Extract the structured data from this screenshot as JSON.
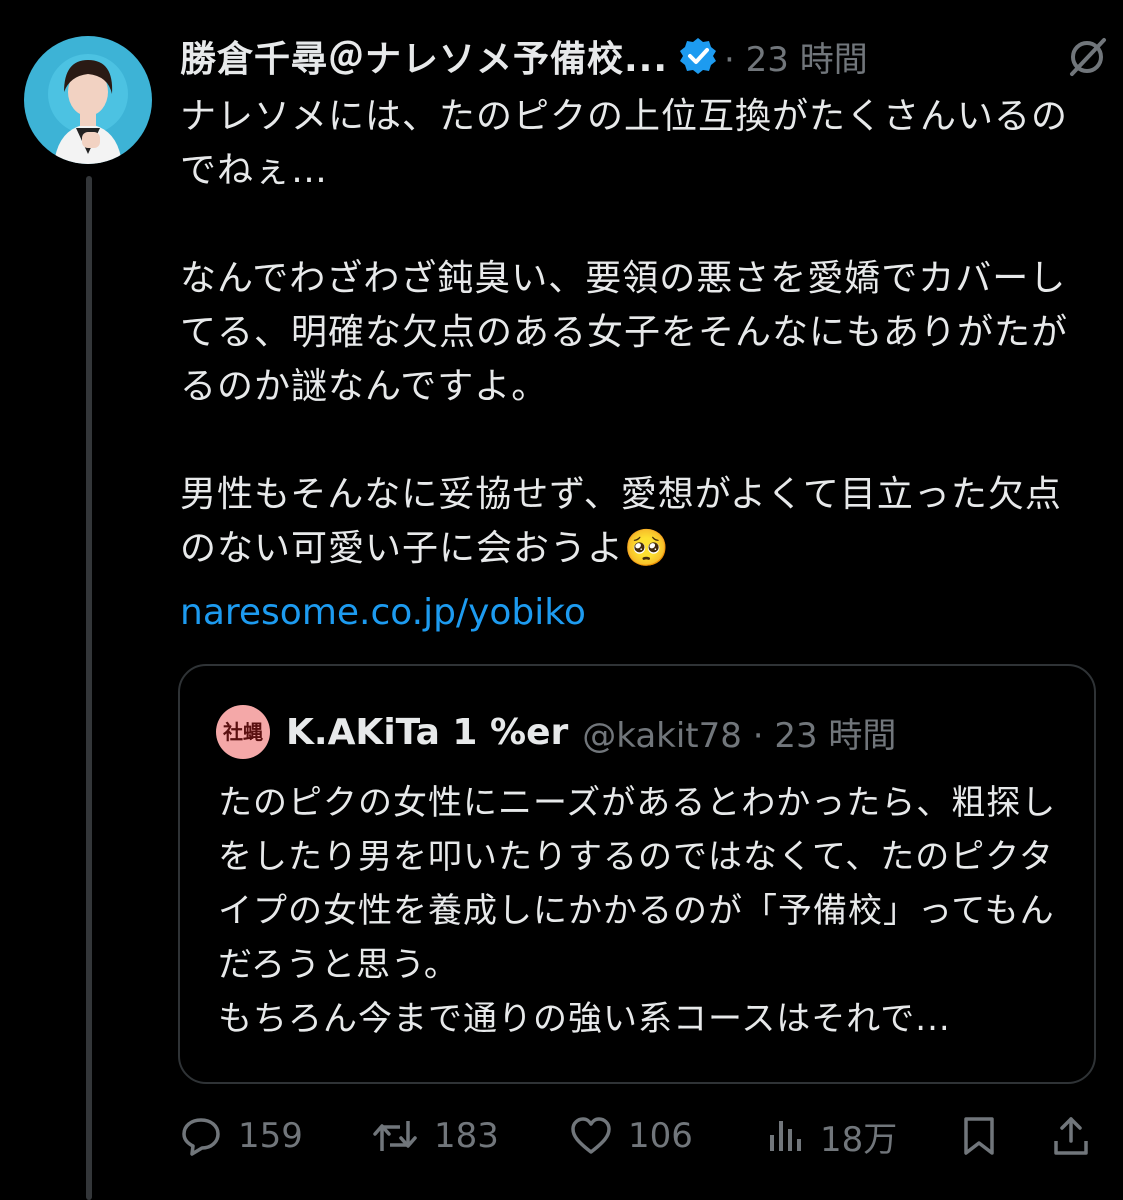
{
  "post": {
    "author_name": "勝倉千尋＠ナレソメ予備校...",
    "meta": "· 23 時間",
    "body": {
      "p1": "ナレソメには、たのピクの上位互換がたくさんいるのでねぇ…",
      "p2": "なんでわざわざ鈍臭い、要領の悪さを愛嬌でカバーしてる、明確な欠点のある女子をそんなにもありがたがるのか謎なんですよ。",
      "p3": "男性もそんなに妥協せず、愛想がよくて目立った欠点のない可愛い子に会おうよ🥺"
    },
    "link": "naresome.co.jp/yobiko"
  },
  "quote": {
    "avatar_text": "社蝿",
    "name": "K.AKiTa 1 %er",
    "handle_meta": "@kakit78 · 23 時間",
    "text": "たのピクの女性にニーズがあるとわかったら、粗探しをしたり男を叩いたりするのではなくて、たのピクタイプの女性を養成しにかかるのが「予備校」ってもんだろうと思う。\nもちろん今まで通りの強い系コースはそれで..."
  },
  "actions": {
    "replies": "159",
    "reposts": "183",
    "likes": "106",
    "views": "18万"
  },
  "colors": {
    "background": "#000000",
    "text": "#e7e9ea",
    "muted": "#71767b",
    "link": "#1d9bf0",
    "verified": "#1d9bf0",
    "border": "#2f3336"
  },
  "icons": [
    "verified-badge-icon",
    "grok-icon",
    "reply-icon",
    "repost-icon",
    "like-icon",
    "views-icon",
    "bookmark-icon",
    "share-icon"
  ]
}
